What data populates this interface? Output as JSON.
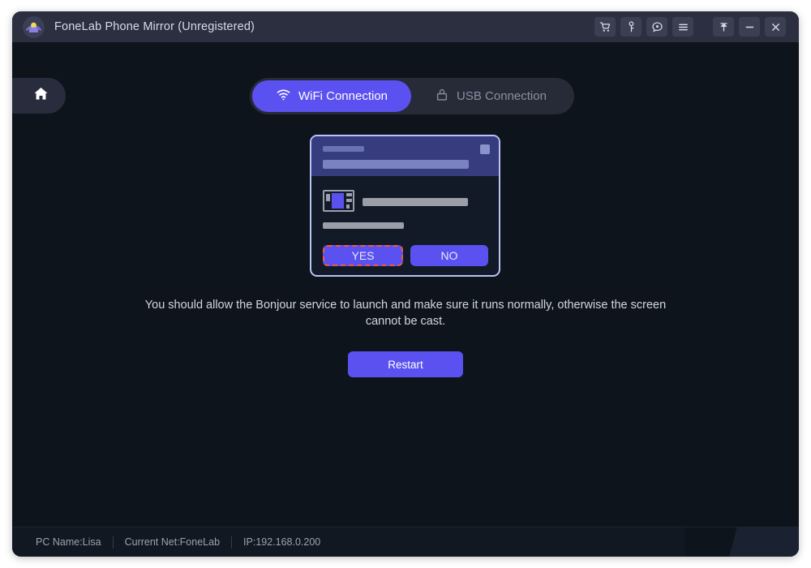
{
  "window": {
    "title": "FoneLab Phone Mirror (Unregistered)",
    "logo_icon": "broadcast-cast-icon",
    "accent_color": "#5b51f0",
    "titlebar_color": "#2b2f40",
    "background_color": "#0e141c"
  },
  "titlebar_buttons": {
    "cart": {
      "label": "",
      "icon": "shopping-cart-icon"
    },
    "register": {
      "label": "",
      "icon": "key-icon"
    },
    "feedback": {
      "label": "",
      "icon": "feedback-bubble-icon"
    },
    "menu": {
      "label": "",
      "icon": "hamburger-menu-icon"
    },
    "pin": {
      "label": "",
      "icon": "pin-icon"
    },
    "minimize": {
      "label": "",
      "icon": "minimize-icon"
    },
    "close": {
      "label": "",
      "icon": "close-icon"
    }
  },
  "header": {
    "home_icon": "home-icon",
    "tabs": [
      {
        "id": "wifi",
        "label": "WiFi Connection",
        "icon": "wifi-icon",
        "active": true
      },
      {
        "id": "usb",
        "label": "USB Connection",
        "icon": "usb-plug-icon",
        "active": false
      }
    ]
  },
  "illustration": {
    "app_icon": "window-app-icon",
    "close_icon": "dialog-close-placeholder",
    "yes_label": "YES",
    "no_label": "NO",
    "highlight_color": "#ef5a3c",
    "header_color": "#363c7d"
  },
  "main": {
    "instruction": "You should allow the Bonjour service to launch and make sure it runs normally, otherwise the screen cannot be cast.",
    "restart_label": "Restart"
  },
  "status_bar": {
    "pc_name": "PC Name:Lisa",
    "current_net": "Current Net:FoneLab",
    "ip": "IP:192.168.0.200"
  }
}
